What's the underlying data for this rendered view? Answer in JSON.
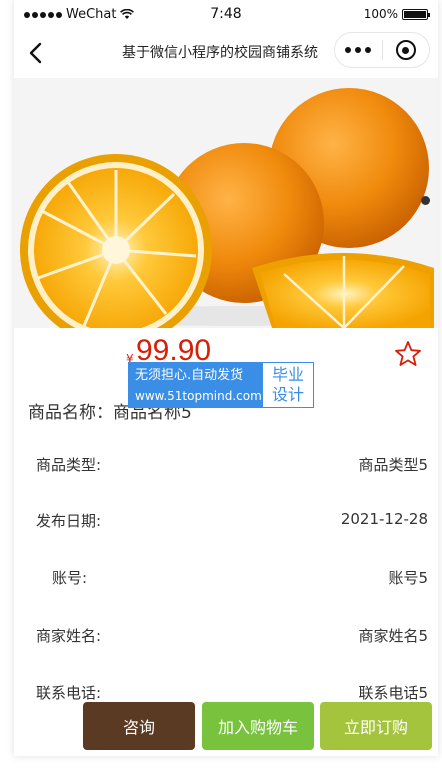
{
  "status_bar": {
    "carrier": "WeChat",
    "time": "7:48",
    "battery": "100%",
    "battery_level": 1.0
  },
  "nav": {
    "title": "基于微信小程序的校园商铺系统"
  },
  "product": {
    "price_symbol": "¥",
    "price": "99.90",
    "name": "商品名称：商品名称5"
  },
  "watermark": {
    "line1": "无须担心.自动发货",
    "line2": "www.51topmind.com",
    "right1": "毕业",
    "right2": "设计"
  },
  "info": [
    {
      "label": "商品类型:",
      "value": "商品类型5"
    },
    {
      "label": "发布日期:",
      "value": "2021-12-28"
    },
    {
      "label": "账号:",
      "value": "账号5"
    },
    {
      "label": "商家姓名:",
      "value": "商家姓名5"
    },
    {
      "label": "联系电话:",
      "value": "联系电话5"
    }
  ],
  "buttons": {
    "consult": "咨询",
    "add_cart": "加入购物车",
    "buy_now": "立即订购"
  },
  "colors": {
    "price": "#d81e06",
    "consult_btn": "#5a3a22",
    "cart_btn": "#78c23e",
    "buy_btn": "#a5c43e",
    "watermark": "#3a8ee6"
  },
  "icons": {
    "back": "chevron-left-icon",
    "more": "more-dots-icon",
    "close": "capsule-close-icon",
    "favorite": "star-outline-icon",
    "wifi": "wifi-icon",
    "battery": "battery-icon"
  }
}
